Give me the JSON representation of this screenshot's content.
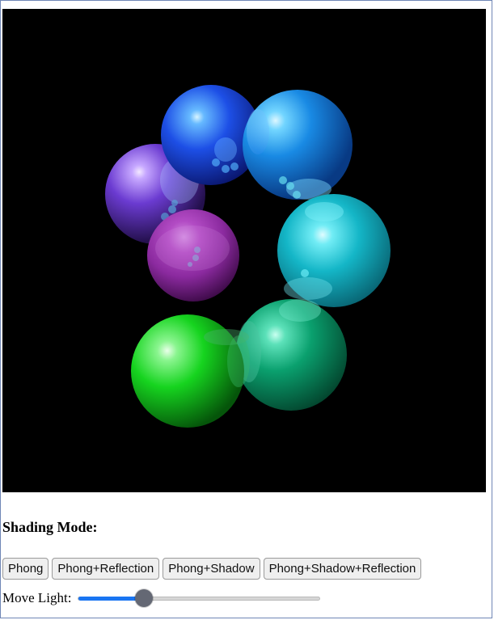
{
  "shading": {
    "title": "Shading Mode:",
    "buttons": [
      {
        "label": "Phong"
      },
      {
        "label": "Phong+Reflection"
      },
      {
        "label": "Phong+Shadow"
      },
      {
        "label": "Phong+Shadow+Reflection"
      }
    ]
  },
  "light": {
    "label": "Move Light:",
    "slider_value": 0.27
  },
  "scene": {
    "background": "#000000",
    "spheres": [
      {
        "color": "#5e2dbf"
      },
      {
        "color": "#1f56ee"
      },
      {
        "color": "#1b8ee7"
      },
      {
        "color": "#12b7cc"
      },
      {
        "color": "#a130b5"
      },
      {
        "color": "#0da36e"
      },
      {
        "color": "#16d61f"
      }
    ]
  }
}
